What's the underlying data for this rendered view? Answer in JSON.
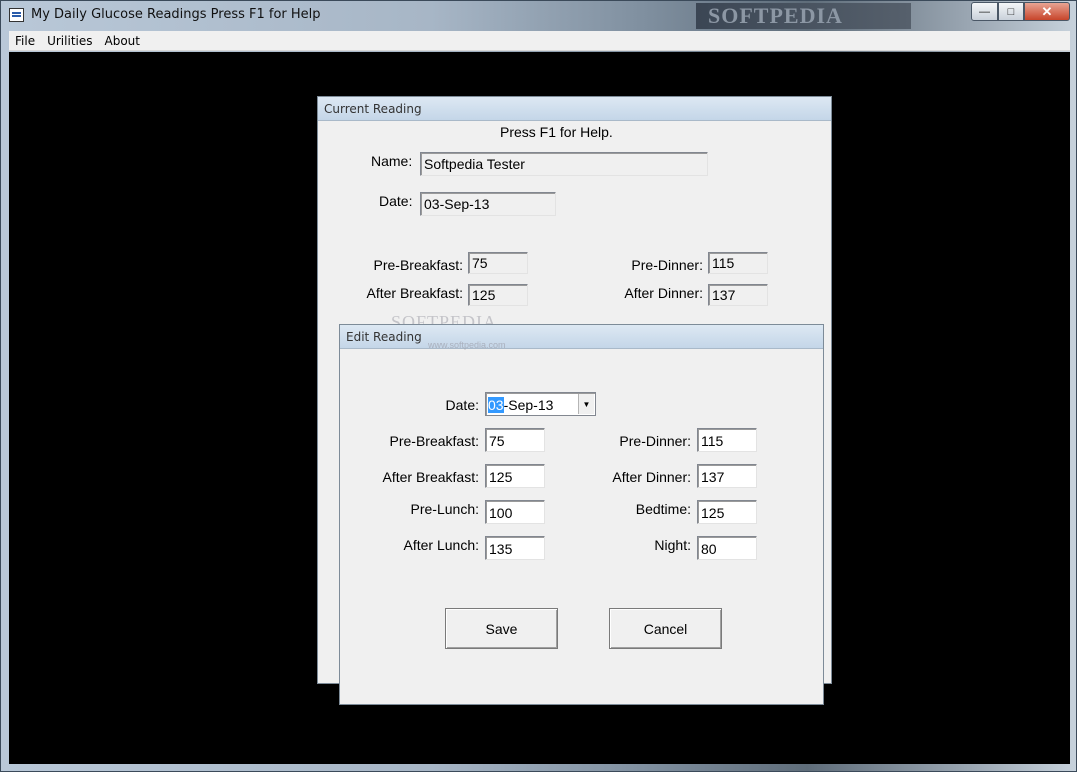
{
  "window": {
    "title": "My Daily Glucose Readings  Press F1 for Help",
    "watermark": "SOFTPEDIA",
    "caption_buttons": {
      "minimize": "—",
      "maximize": "□",
      "close": "✕"
    }
  },
  "menu": {
    "items": [
      "File",
      "Urilities",
      "About"
    ]
  },
  "current_reading": {
    "title": "Current Reading",
    "help": "Press F1 for Help.",
    "name_label": "Name:",
    "name_value": "Softpedia Tester",
    "date_label": "Date:",
    "date_value": "03-Sep-13",
    "pre_breakfast_label": "Pre-Breakfast:",
    "pre_breakfast_value": "75",
    "after_breakfast_label": "After Breakfast:",
    "after_breakfast_value": "125",
    "pre_dinner_label": "Pre-Dinner:",
    "pre_dinner_value": "115",
    "after_dinner_label": "After Dinner:",
    "after_dinner_value": "137"
  },
  "edit_reading": {
    "title": "Edit Reading",
    "date_label": "Date:",
    "date_selected": "03",
    "date_rest": "-Sep-13",
    "pre_breakfast_label": "Pre-Breakfast:",
    "pre_breakfast_value": "75",
    "after_breakfast_label": "After Breakfast:",
    "after_breakfast_value": "125",
    "pre_lunch_label": "Pre-Lunch:",
    "pre_lunch_value": "100",
    "after_lunch_label": "After Lunch:",
    "after_lunch_value": "135",
    "pre_dinner_label": "Pre-Dinner:",
    "pre_dinner_value": "115",
    "after_dinner_label": "After Dinner:",
    "after_dinner_value": "137",
    "bedtime_label": "Bedtime:",
    "bedtime_value": "125",
    "night_label": "Night:",
    "night_value": "80",
    "save_label": "Save",
    "cancel_label": "Cancel"
  },
  "overlay": {
    "watermark": "SOFTPEDIA",
    "url": "www.softpedia.com"
  }
}
